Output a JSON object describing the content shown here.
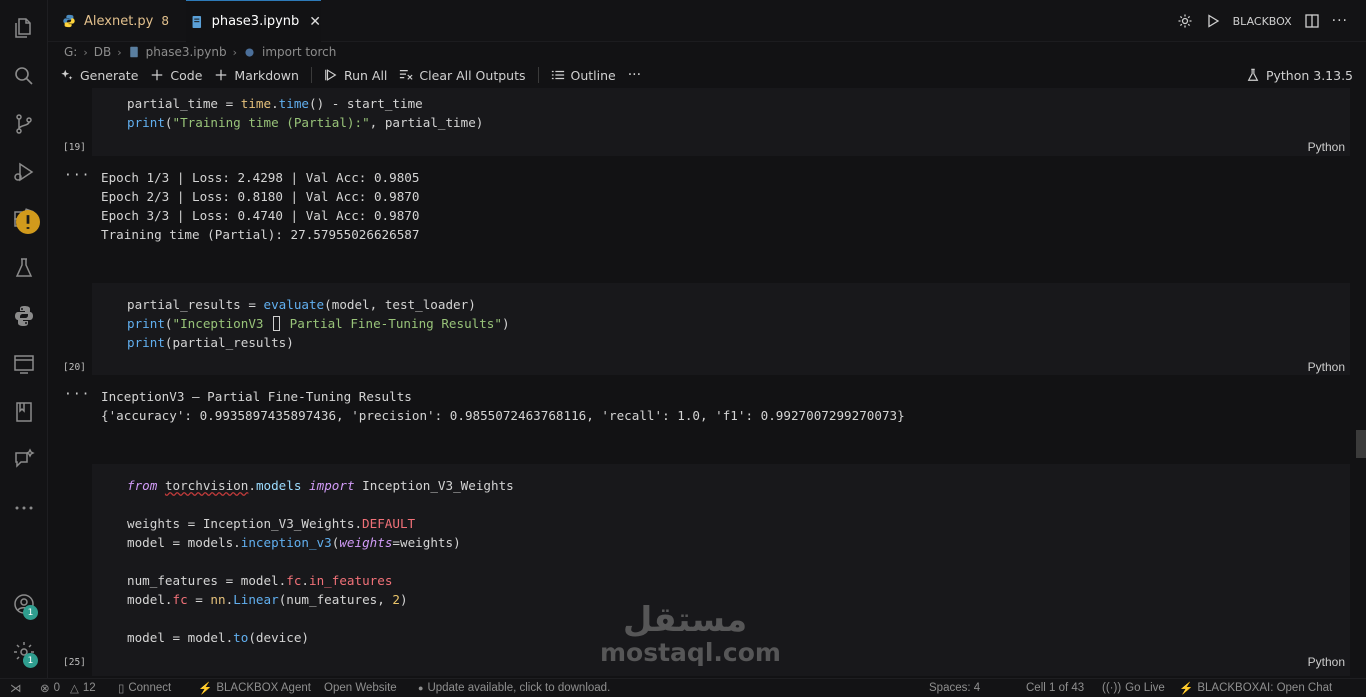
{
  "tabs": [
    {
      "label": "Alexnet.py",
      "problems": "8"
    },
    {
      "label": "phase3.ipynb"
    }
  ],
  "topright": {
    "blackbox": "BLACKBOX"
  },
  "breadcrumb": {
    "drive": "G:",
    "folder": "DB",
    "file": "phase3.ipynb",
    "symbol": "import torch"
  },
  "toolbar": {
    "generate": "Generate",
    "code": "Code",
    "markdown": "Markdown",
    "run_all": "Run All",
    "clear_outputs": "Clear All Outputs",
    "outline": "Outline",
    "more": "···",
    "kernel": "Python 3.13.5"
  },
  "cells": [
    {
      "exec": "[19]",
      "lang": "Python"
    },
    {
      "exec": "[20]",
      "lang": "Python"
    },
    {
      "exec": "[25]",
      "lang": "Python"
    }
  ],
  "output1": [
    "Epoch 1/3 | Loss: 2.4298 | Val Acc: 0.9805",
    "Epoch 2/3 | Loss: 0.8180 | Val Acc: 0.9870",
    "Epoch 3/3 | Loss: 0.4740 | Val Acc: 0.9870",
    "Training time (Partial): 27.57955026626587"
  ],
  "output2": [
    "InceptionV3 – Partial Fine-Tuning Results",
    "{'accuracy': 0.9935897435897436, 'precision': 0.9855072463768116, 'recall': 1.0, 'f1': 0.9927007299270073}"
  ],
  "output_more": "···",
  "watermark": {
    "arabic": "مستقل",
    "latin": "mostaql.com"
  },
  "activity_badges": {
    "accounts": "1",
    "settings": "1"
  },
  "status": {
    "errors": "0",
    "warnings": "12",
    "connect": "Connect",
    "blackbox_agent": "BLACKBOX Agent",
    "open_website": "Open Website",
    "update": "Update available, click to download.",
    "spaces": "Spaces: 4",
    "cell": "Cell 1 of 43",
    "go_live": "Go Live",
    "open_chat": "BLACKBOXAI: Open Chat"
  }
}
